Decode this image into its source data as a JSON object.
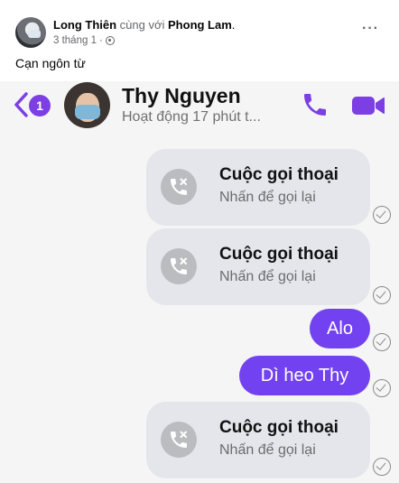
{
  "post": {
    "author": "Long Thiên",
    "with_text": "cùng với",
    "tagged": "Phong Lam",
    "tagged_suffix": ".",
    "time": "3 tháng 1",
    "dot": "·",
    "more": "···",
    "caption": "Cạn ngôn từ"
  },
  "chat": {
    "back_badge": "1",
    "contact_name": "Thy Nguyen",
    "contact_status": "Hoạt động 17 phút t...",
    "messages": [
      {
        "type": "call",
        "title": "Cuộc gọi thoại",
        "subtitle": "Nhấn để gọi lại"
      },
      {
        "type": "call",
        "title": "Cuộc gọi thoại",
        "subtitle": "Nhấn để gọi lại"
      },
      {
        "type": "text",
        "text": "Alo"
      },
      {
        "type": "text",
        "text": "Dì heo Thy"
      },
      {
        "type": "call",
        "title": "Cuộc gọi thoại",
        "subtitle": "Nhấn để gọi lại"
      }
    ]
  },
  "colors": {
    "accent": "#7342f0",
    "call_bubble": "#e4e6eb"
  },
  "icons": [
    "back-arrow-icon",
    "phone-icon",
    "video-camera-icon",
    "missed-call-icon",
    "seen-check-icon",
    "globe-icon",
    "more-icon"
  ]
}
